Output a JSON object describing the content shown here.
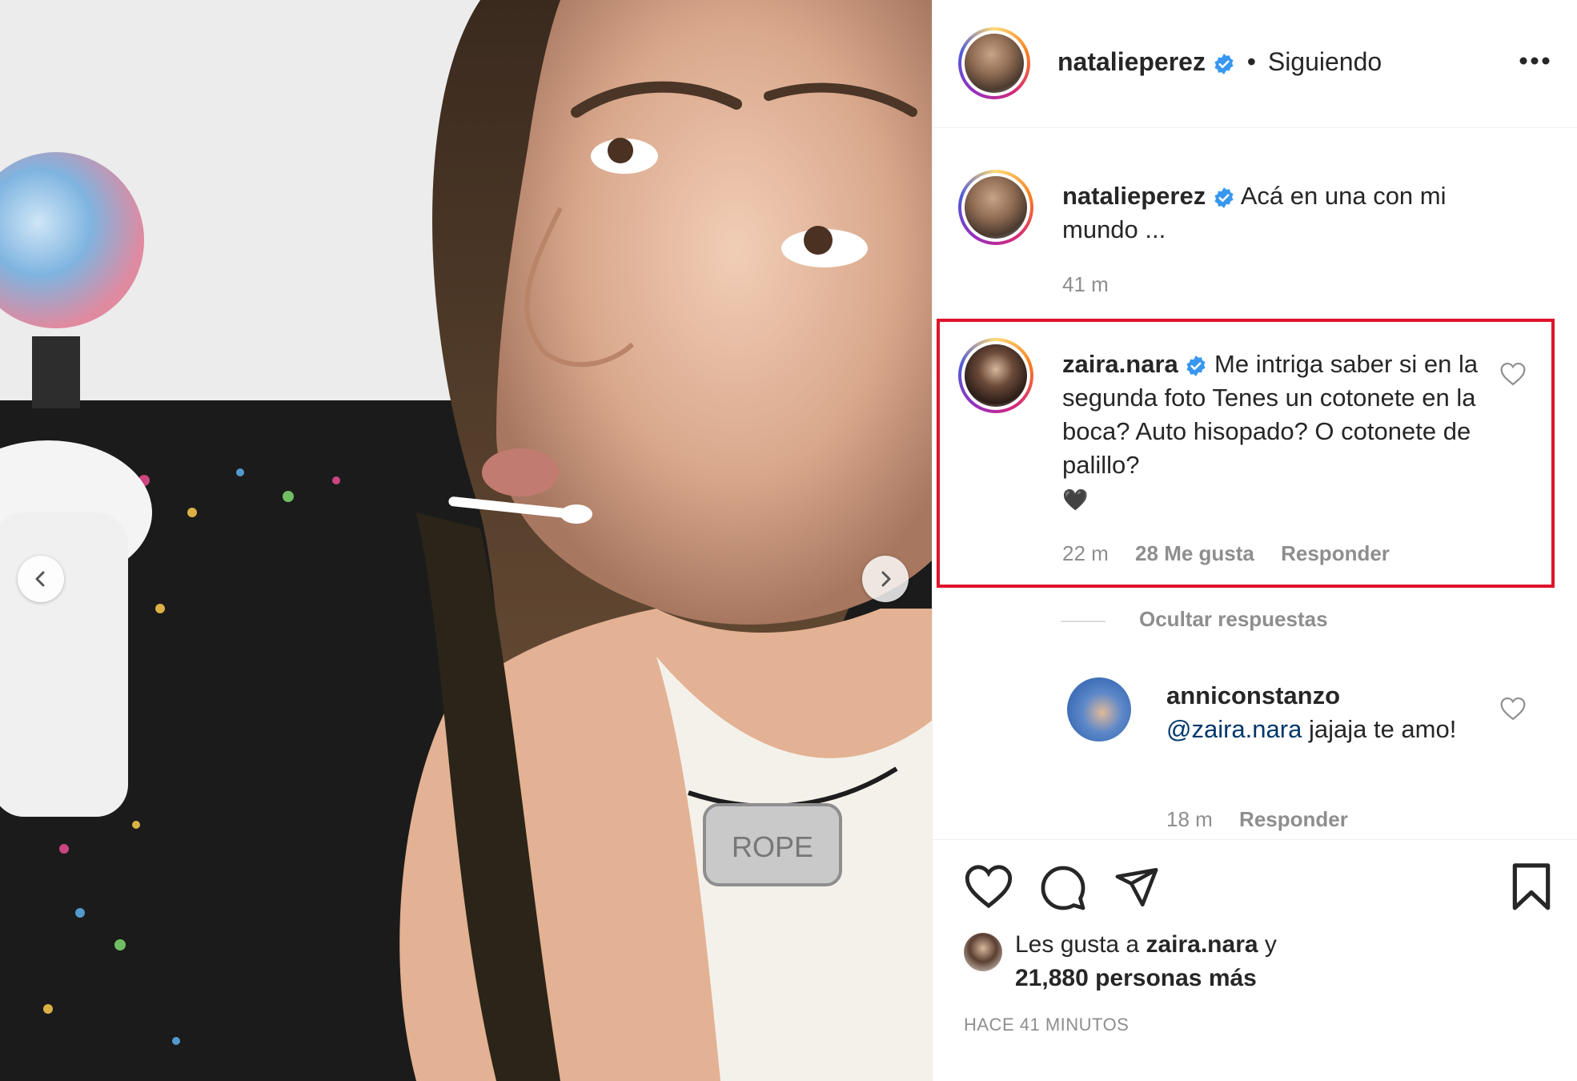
{
  "post": {
    "author": "natalieperez",
    "separator": "•",
    "follow_status": "Siguiendo",
    "caption": "Acá en una con mi mundo ...",
    "caption_time": "41 m",
    "photo_text": "ROPE"
  },
  "comments": [
    {
      "user": "zaira.nara",
      "text": "Me intriga saber si en la segunda foto Tenes un cotonete en la boca? Auto hisopado? O cotonete de palillo?",
      "emoji": "🖤",
      "time": "22 m",
      "likes": "28 Me gusta",
      "reply": "Responder"
    }
  ],
  "replies_toggle": "Ocultar respuestas",
  "replies": [
    {
      "user": "anniconstanzo",
      "mention": "@zaira.nara",
      "text": "jajaja te amo!",
      "time": "18 m",
      "reply": "Responder"
    }
  ],
  "likes": {
    "prefix": "Les gusta a",
    "user": "zaira.nara",
    "joiner": "y",
    "others": "21,880 personas más"
  },
  "time_ago": "HACE 41 MINUTOS",
  "colors": {
    "highlight_border": "#e0132b",
    "verified_blue": "#3897f0",
    "mention_blue": "#00376b",
    "muted_text": "#8e8e8e"
  }
}
